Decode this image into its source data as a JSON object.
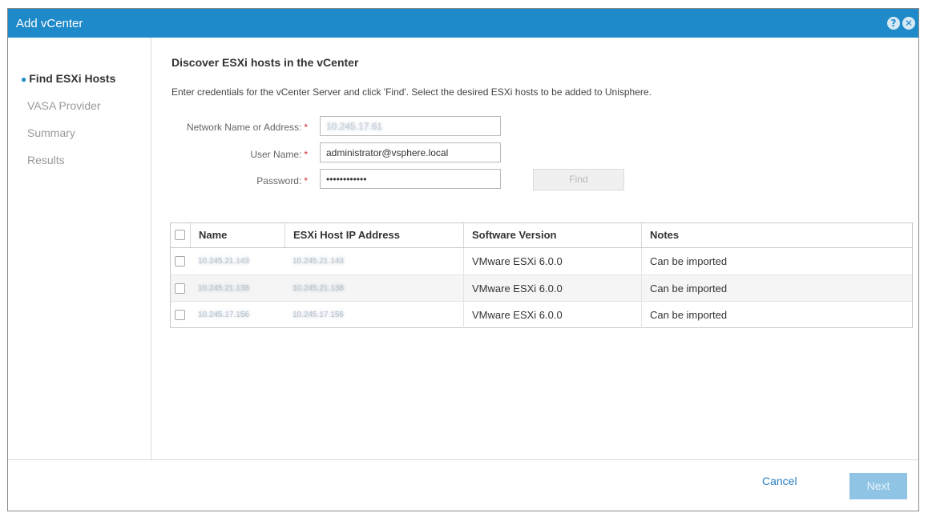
{
  "dialog": {
    "title": "Add vCenter",
    "help_icon": "help-icon",
    "close_icon": "close-icon"
  },
  "sidebar": {
    "steps": [
      {
        "label": "Find ESXi Hosts",
        "active": true
      },
      {
        "label": "VASA Provider",
        "active": false
      },
      {
        "label": "Summary",
        "active": false
      },
      {
        "label": "Results",
        "active": false
      }
    ]
  },
  "main": {
    "heading": "Discover ESXi hosts in the vCenter",
    "instructions": "Enter credentials for the vCenter Server and click 'Find'. Select the desired ESXi hosts to be added to Unisphere.",
    "form": {
      "network_label": "Network Name or Address:",
      "network_value": "10.245.17.61",
      "username_label": "User Name:",
      "username_value": "administrator@vsphere.local",
      "password_label": "Password:",
      "password_value": "••••••••••••",
      "required_mark": "*",
      "find_label": "Find"
    },
    "table": {
      "columns": [
        "Name",
        "ESXi Host IP Address",
        "Software Version",
        "Notes"
      ],
      "rows": [
        {
          "name": "10.245.21.143",
          "ip": "10.245.21.143",
          "version": "VMware ESXi 6.0.0",
          "notes": "Can be imported"
        },
        {
          "name": "10.245.21.138",
          "ip": "10.245.21.138",
          "version": "VMware ESXi 6.0.0",
          "notes": "Can be imported"
        },
        {
          "name": "10.245.17.156",
          "ip": "10.245.17.156",
          "version": "VMware ESXi 6.0.0",
          "notes": "Can be imported"
        }
      ]
    }
  },
  "footer": {
    "cancel_label": "Cancel",
    "next_label": "Next"
  },
  "colors": {
    "titlebar": "#1f8ac9",
    "next_disabled": "#8fc4e4",
    "required": "#d0312d"
  }
}
